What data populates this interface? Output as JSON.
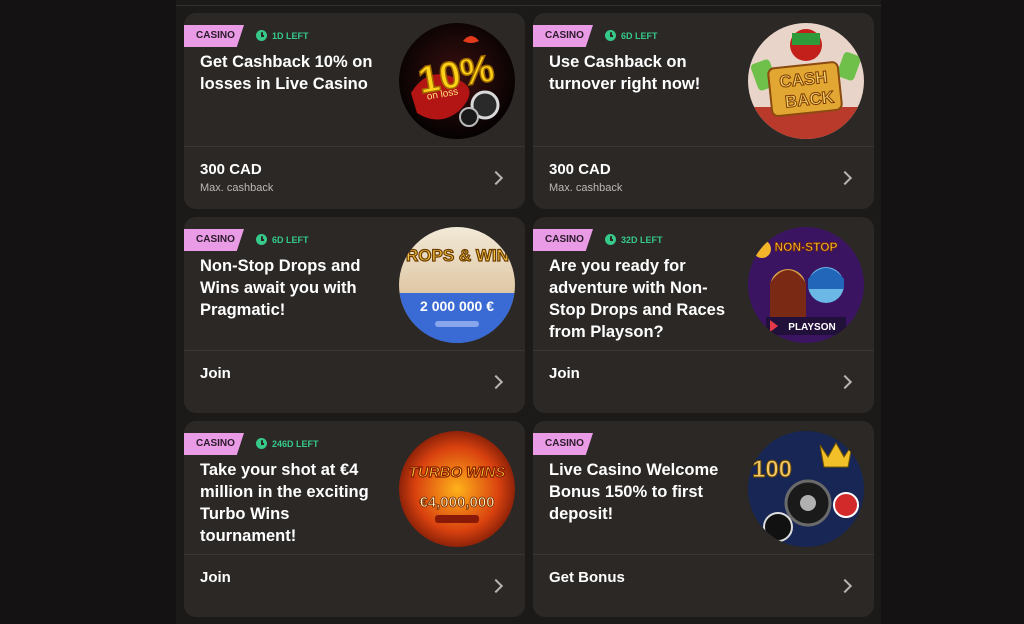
{
  "cards": [
    {
      "tag": "CASINO",
      "time_left": "1D LEFT",
      "title": "Get Cashback 10% on losses in Live Casino",
      "cta": "300 CAD",
      "sub": "Max. cashback",
      "art_text": "10%",
      "art_sub": "on loss",
      "icon": "cashback-10-percent-image"
    },
    {
      "tag": "CASINO",
      "time_left": "6D LEFT",
      "title": "Use Cashback on turnover right now!",
      "cta": "300 CAD",
      "sub": "Max. cashback",
      "art_text": "CASH",
      "art_sub": "BACK",
      "icon": "cashback-turnover-image"
    },
    {
      "tag": "CASINO",
      "time_left": "6D LEFT",
      "title": "Non-Stop Drops and Wins await you with Pragmatic!",
      "cta": "Join",
      "art_text": "DROPS & WINS",
      "art_sub": "2 000 000 €",
      "icon": "drops-and-wins-image"
    },
    {
      "tag": "CASINO",
      "time_left": "32D LEFT",
      "title": "Are you ready for adventure with Non-Stop Drops and Races from Playson?",
      "cta": "Join",
      "art_text": "NON-STOP",
      "art_sub": "PLAYSON",
      "icon": "playson-drops-races-image"
    },
    {
      "tag": "CASINO",
      "time_left": "246D LEFT",
      "title": "Take your shot at €4 million in the exciting Turbo Wins tournament!",
      "cta": "Join",
      "art_text": "TURBO WINS",
      "art_sub": "€4,000,000",
      "icon": "turbo-wins-image"
    },
    {
      "tag": "CASINO",
      "time_left": "",
      "title": "Live Casino Welcome Bonus 150% to first deposit!",
      "cta": "Get Bonus",
      "art_text": "100",
      "icon": "live-casino-bonus-image"
    }
  ],
  "colors": {
    "tag_bg": "#e99be6",
    "timer": "#36c98a",
    "card_bg": "#2b2826",
    "page_bg": "#1c1a19"
  }
}
